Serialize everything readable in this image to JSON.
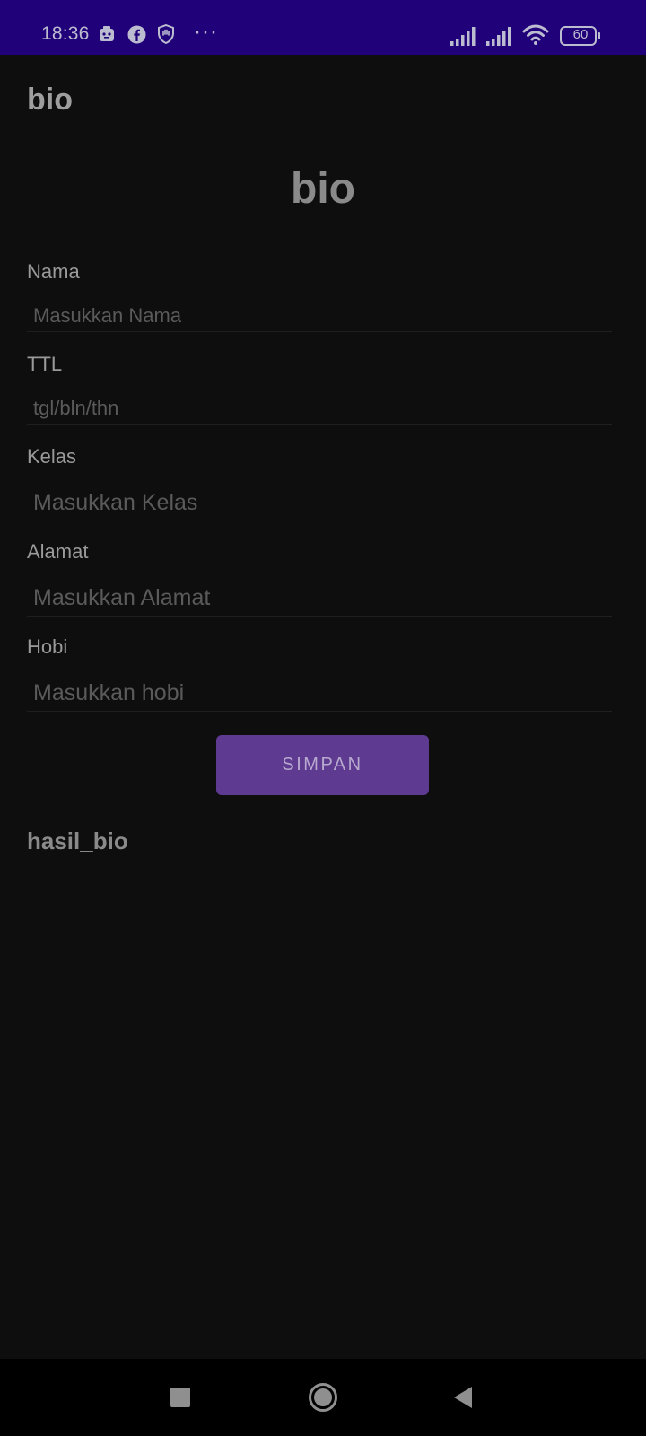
{
  "status_bar": {
    "time": "18:36",
    "battery_level": "60",
    "more_dots": "···",
    "background_color": "#21017a",
    "icons": [
      "gallery-notification-icon",
      "facebook-icon",
      "shield-hand-icon",
      "cell-signal-icon",
      "cell-signal-icon",
      "wifi-icon",
      "battery-icon"
    ]
  },
  "app_bar": {
    "title": "bio"
  },
  "form": {
    "heading": "bio",
    "fields": [
      {
        "label": "Nama",
        "placeholder": "Masukkan Nama",
        "value": ""
      },
      {
        "label": "TTL",
        "placeholder": "tgl/bln/thn",
        "value": ""
      },
      {
        "label": "Kelas",
        "placeholder": "Masukkan Kelas",
        "value": ""
      },
      {
        "label": "Alamat",
        "placeholder": "Masukkan Alamat",
        "value": ""
      },
      {
        "label": "Hobi",
        "placeholder": "Masukkan hobi",
        "value": ""
      }
    ],
    "submit_label": "SIMPAN",
    "accent_color": "#5e3b91"
  },
  "result": {
    "text": "hasil_bio"
  },
  "nav_bar": {
    "buttons": [
      "recents-square-icon",
      "home-circle-icon",
      "back-triangle-icon"
    ]
  }
}
